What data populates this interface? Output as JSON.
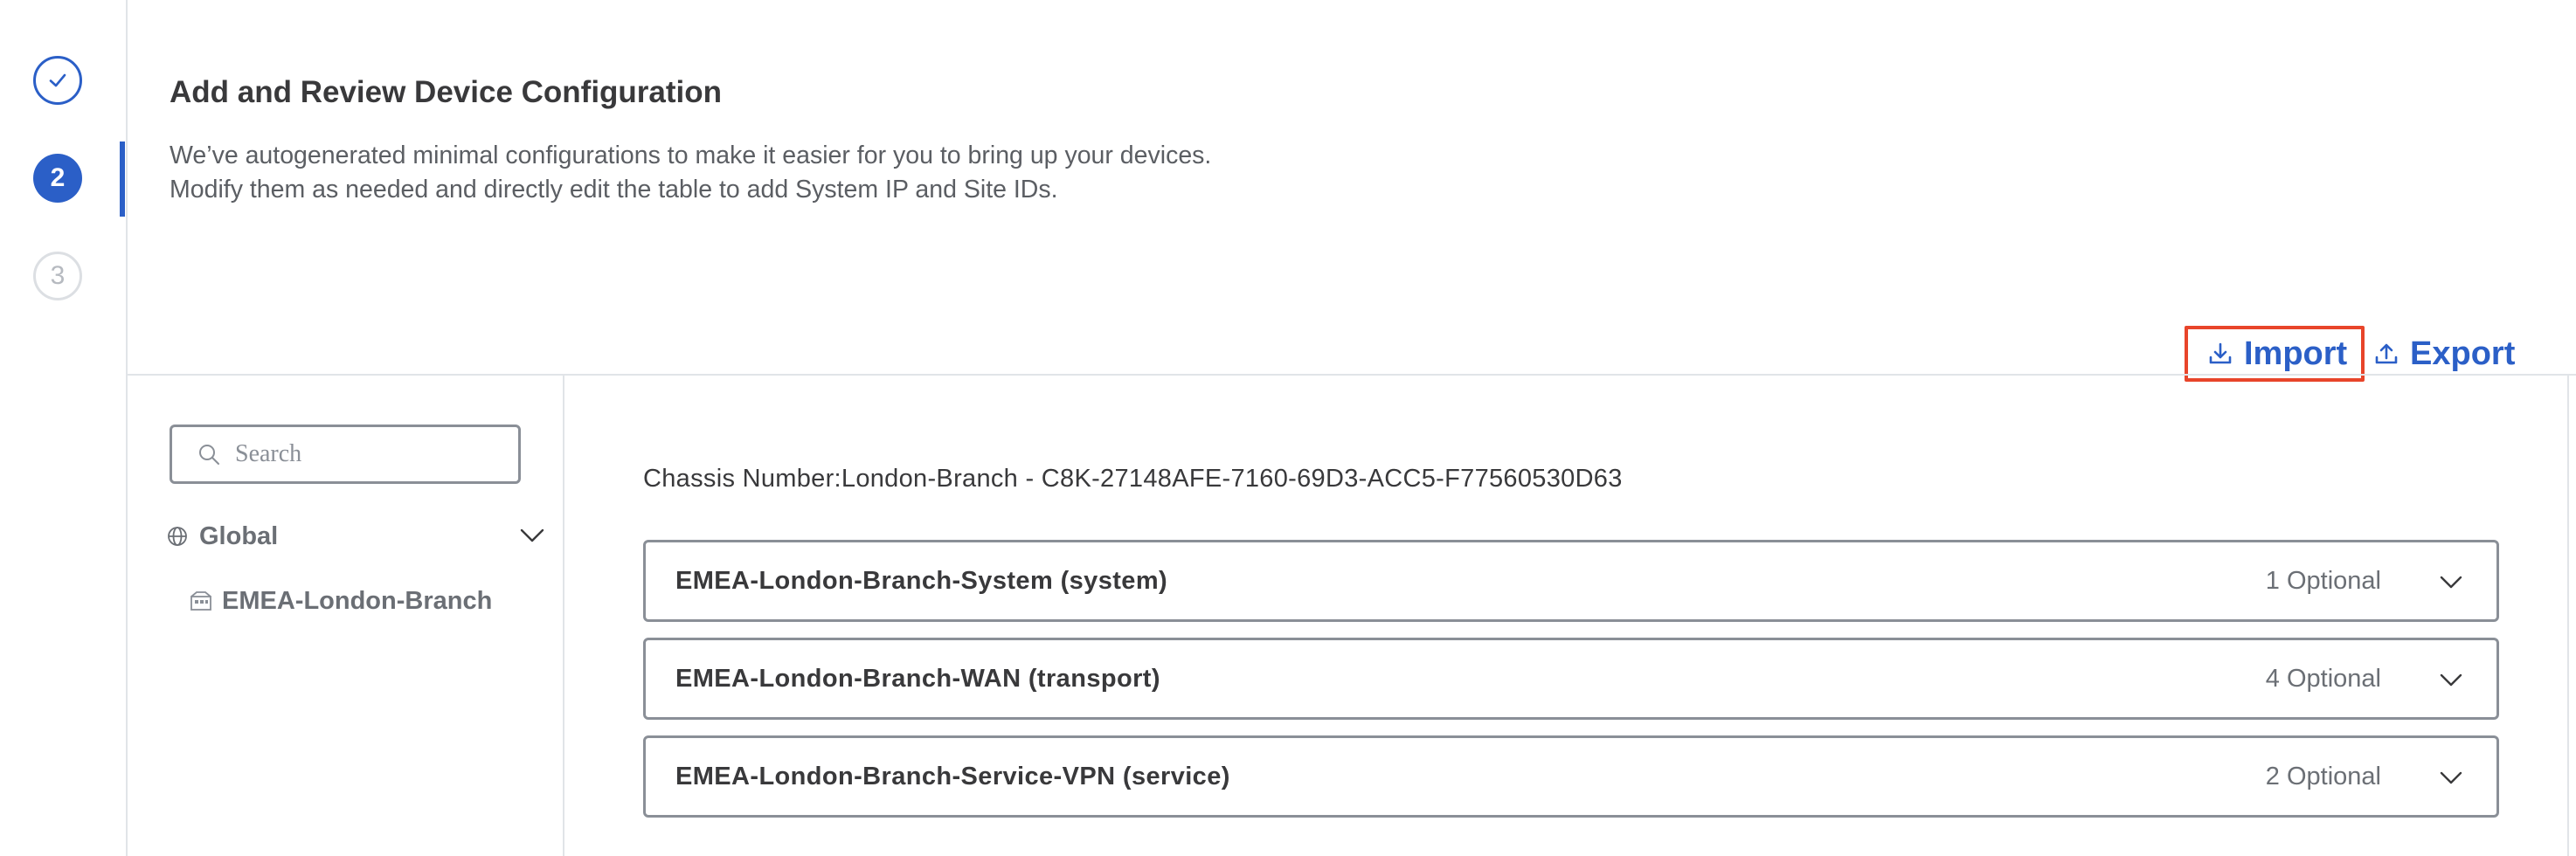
{
  "stepper": {
    "steps": [
      {
        "state": "completed",
        "icon": "check-icon"
      },
      {
        "state": "active",
        "number": "2"
      },
      {
        "state": "pending",
        "number": "3"
      }
    ]
  },
  "header": {
    "title": "Add and Review Device Configuration",
    "description_line1": "We’ve autogenerated minimal configurations to make it easier for you to bring up your devices.",
    "description_line2": "Modify them as needed and directly edit the table to add System IP and Site IDs."
  },
  "actions": {
    "import_label": "Import",
    "export_label": "Export"
  },
  "tree": {
    "search_placeholder": "Search",
    "root_label": "Global",
    "child_label": "EMEA-London-Branch"
  },
  "main": {
    "chassis_label": "Chassis Number:London-Branch - C8K-27148AFE-7160-69D3-ACC5-F77560530D63",
    "sections": [
      {
        "name": "EMEA-London-Branch-System (system)",
        "optional": "1 Optional"
      },
      {
        "name": "EMEA-London-Branch-WAN (transport)",
        "optional": "4 Optional"
      },
      {
        "name": "EMEA-London-Branch-Service-VPN (service)",
        "optional": "2 Optional"
      }
    ]
  },
  "colors": {
    "accent": "#2b5fc7",
    "highlight_border": "#e8452a",
    "text": "#39393b"
  }
}
